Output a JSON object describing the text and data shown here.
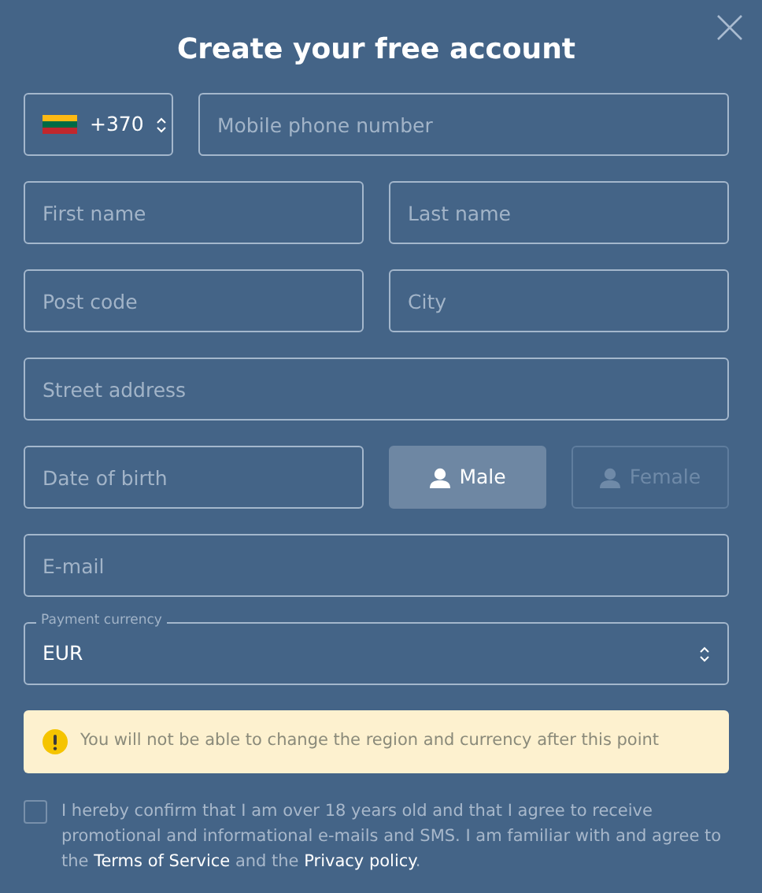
{
  "title": "Create your free account",
  "phone": {
    "code": "+370",
    "placeholder": "Mobile phone number"
  },
  "fields": [
    [
      {
        "placeholder": "First name"
      },
      {
        "placeholder": "Last name"
      }
    ],
    [
      {
        "placeholder": "Post code"
      },
      {
        "placeholder": "City"
      }
    ],
    [
      {
        "placeholder": "Street address"
      }
    ]
  ],
  "birth": {
    "placeholder": "Date of birth"
  },
  "gender": [
    {
      "label": "Male",
      "selected": true
    },
    {
      "label": "Female",
      "selected": false
    }
  ],
  "email": {
    "placeholder": "E-mail"
  },
  "currency": {
    "label": "Payment currency",
    "value": "EUR"
  },
  "warning": "You will not be able to change the region and currency after this point",
  "consent": {
    "checked": false,
    "parts": [
      {
        "kind": "text",
        "text": "I hereby confirm that I am over 18 years old and that I agree to receive promotional and informational e-mails and SMS. I am familiar with and agree to the "
      },
      {
        "kind": "link",
        "text": "Terms of Service"
      },
      {
        "kind": "text",
        "text": " and the "
      },
      {
        "kind": "link",
        "text": "Privacy policy"
      },
      {
        "kind": "text",
        "text": "."
      }
    ]
  }
}
